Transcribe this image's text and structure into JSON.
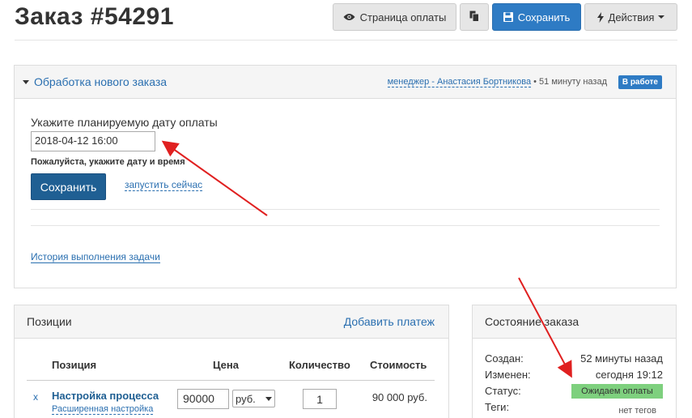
{
  "page": {
    "title": "Заказ #54291"
  },
  "toolbar": {
    "payment_page_label": "Страница оплаты",
    "save_label": "Сохранить",
    "actions_label": "Действия"
  },
  "task": {
    "title": "Обработка нового заказа",
    "manager": "менеджер - Анастасия Бортникова",
    "time_ago": "• 51 минуту назад",
    "status_badge": "В работе",
    "date_label": "Укажите планируемую дату оплаты",
    "date_value": "2018-04-12 16:00",
    "help_text": "Пожалуйста, укажите дату и время",
    "save_button": "Сохранить",
    "run_now": "запустить сейчас",
    "history_link": "История выполнения задачи"
  },
  "positions": {
    "title": "Позиции",
    "add_payment": "Добавить платеж",
    "columns": {
      "position": "Позиция",
      "price": "Цена",
      "quantity": "Количество",
      "total": "Стоимость"
    },
    "rows": [
      {
        "remove": "x",
        "name": "Настройка процесса",
        "sub_link": "Расширенная настройка",
        "price": "90000",
        "currency": "руб.",
        "quantity": "1",
        "total": "90 000 руб."
      }
    ]
  },
  "order_state": {
    "title": "Состояние заказа",
    "created_label": "Создан:",
    "created_value": "52 минуты назад",
    "modified_label": "Изменен:",
    "modified_value": "сегодня 19:12",
    "status_label": "Статус:",
    "status_value": "Ожидаем оплаты",
    "tags_label": "Теги:",
    "tags_value": "нет тегов"
  },
  "colors": {
    "primary": "#2e7bc4",
    "primary_dark": "#1f5f93",
    "link": "#2a6fb0",
    "status_green": "#7ed07e",
    "annotation_arrow": "#e02020"
  },
  "icons": [
    "eye-icon",
    "copy-icon",
    "floppy-disk-icon",
    "bolt-icon",
    "caret-down-icon"
  ]
}
